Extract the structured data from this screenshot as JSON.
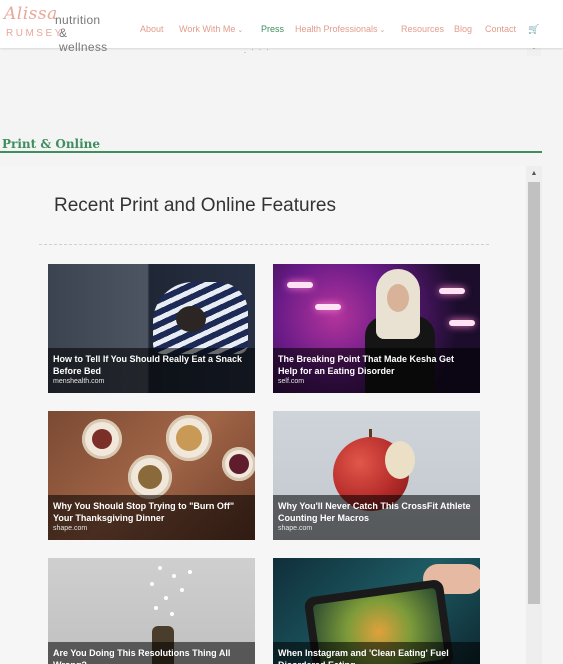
{
  "brand": {
    "script_name": "Alissa",
    "line1": "nutrition",
    "line2_name": "RUMSEY",
    "line2_rest": "& wellness"
  },
  "nav": {
    "about": "About",
    "work_with_me": "Work With Me",
    "press": "Press",
    "health_professionals": "Health Professionals",
    "resources": "Resources",
    "blog": "Blog",
    "contact": "Contact",
    "caret": "⌄",
    "cart": "🛒"
  },
  "embed": {
    "dots": "· ˙ ˙ ˙"
  },
  "section": {
    "title": "Print & Online"
  },
  "widget": {
    "title": "Recent Print and Online Features",
    "cards": [
      {
        "title": "How to Tell If You Should Really Eat a Snack Before Bed",
        "source": "menshealth.com"
      },
      {
        "title": "The Breaking Point That Made Kesha Get Help for an Eating Disorder",
        "source": "self.com"
      },
      {
        "title": "Why You Should Stop Trying to \"Burn Off\" Your Thanksgiving Dinner",
        "source": "shape.com"
      },
      {
        "title": "Why You'll Never Catch This CrossFit Athlete Counting Her Macros",
        "source": "shape.com"
      },
      {
        "title": "Are You Doing This Resolutions Thing All Wrong?",
        "source": ""
      },
      {
        "title": "When Instagram and 'Clean Eating' Fuel Disordered Eating",
        "source": ""
      }
    ]
  },
  "colors": {
    "accent_green": "#3e8e5e",
    "nav_coral": "#e39c8c",
    "logo_pink": "#e8a89a"
  }
}
